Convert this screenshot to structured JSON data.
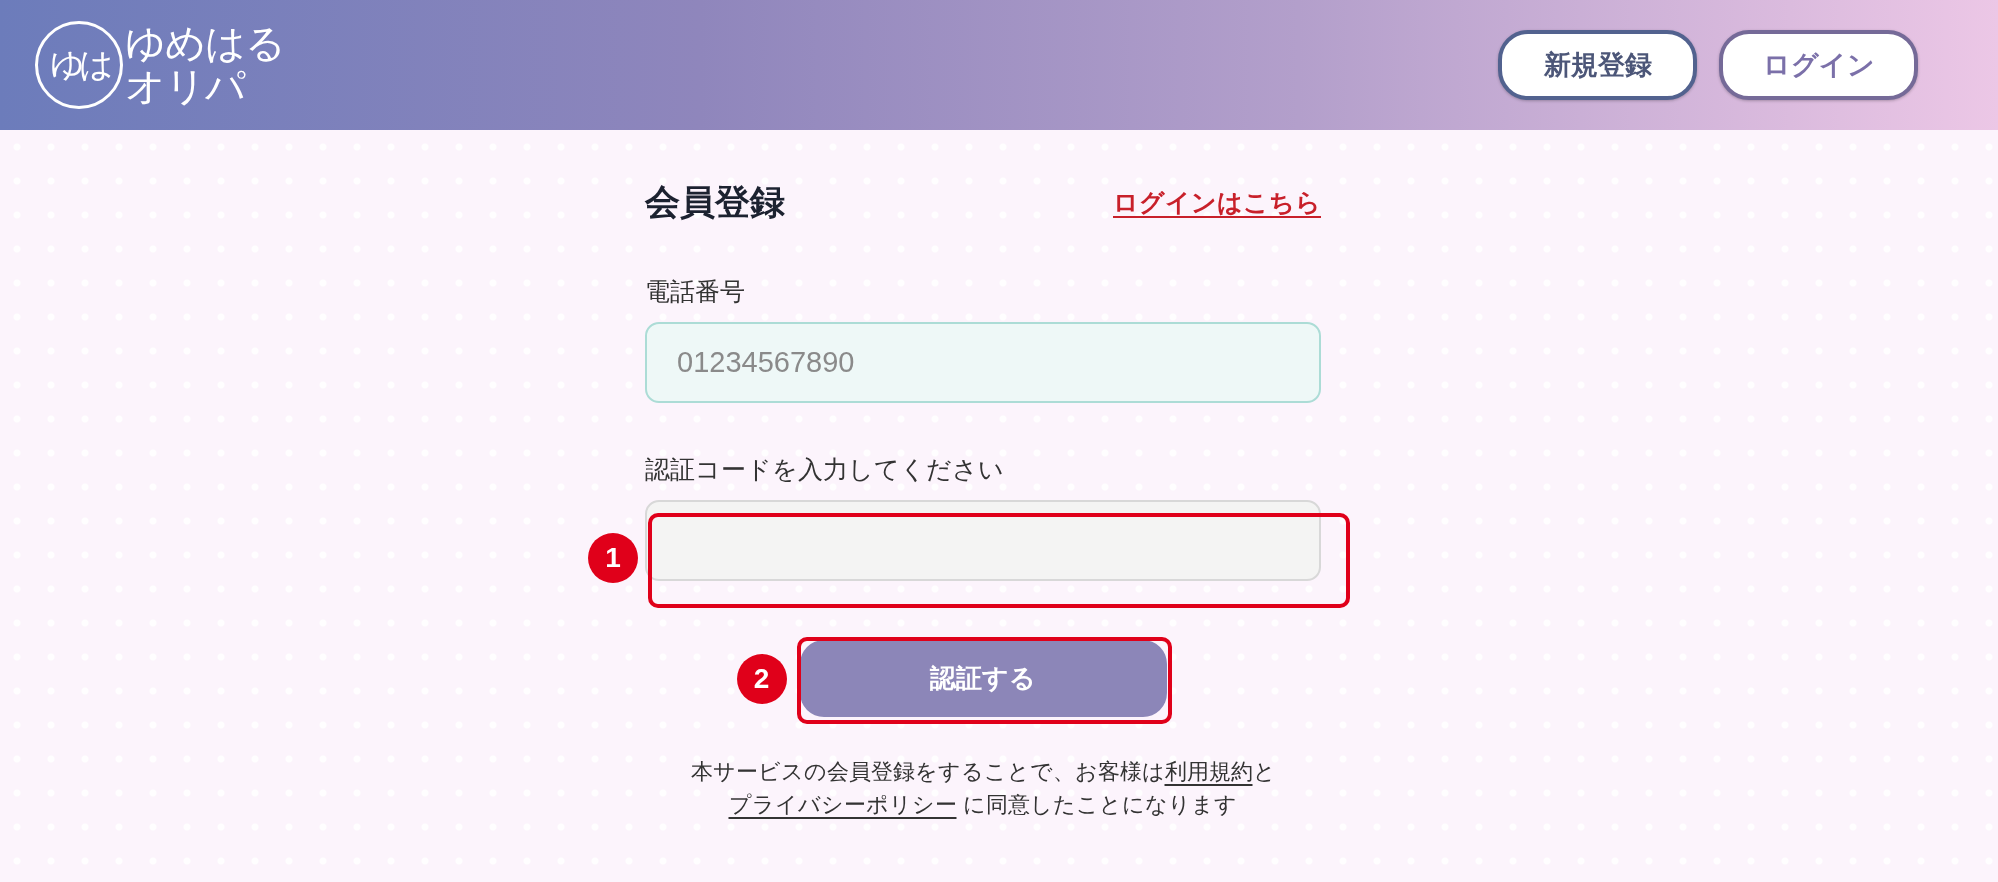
{
  "header": {
    "logo": {
      "mark": "ゆは",
      "name_lines": [
        "ゆめはる",
        "オリパ"
      ]
    },
    "buttons": [
      {
        "label": "新規登録",
        "kind": "signup"
      },
      {
        "label": "ログイン",
        "kind": "login"
      }
    ]
  },
  "form": {
    "title": "会員登録",
    "login_link": "ログインはこちら",
    "fields": [
      {
        "label": "電話番号",
        "kind": "phone",
        "placeholder": "01234567890"
      },
      {
        "label": "認証コードを入力してください",
        "kind": "code",
        "annotation": "1"
      }
    ],
    "submit": {
      "label": "認証する",
      "annotation": "2"
    },
    "notice": [
      {
        "kind": "text",
        "text": "本サービスの会員登録をすることで、お客様は"
      },
      {
        "kind": "link",
        "text": "利用規約"
      },
      {
        "kind": "text",
        "text": "と"
      },
      {
        "kind": "link",
        "text": "プライバシーポリシー"
      },
      {
        "kind": "text",
        "text": " に同意したことになります"
      }
    ]
  }
}
